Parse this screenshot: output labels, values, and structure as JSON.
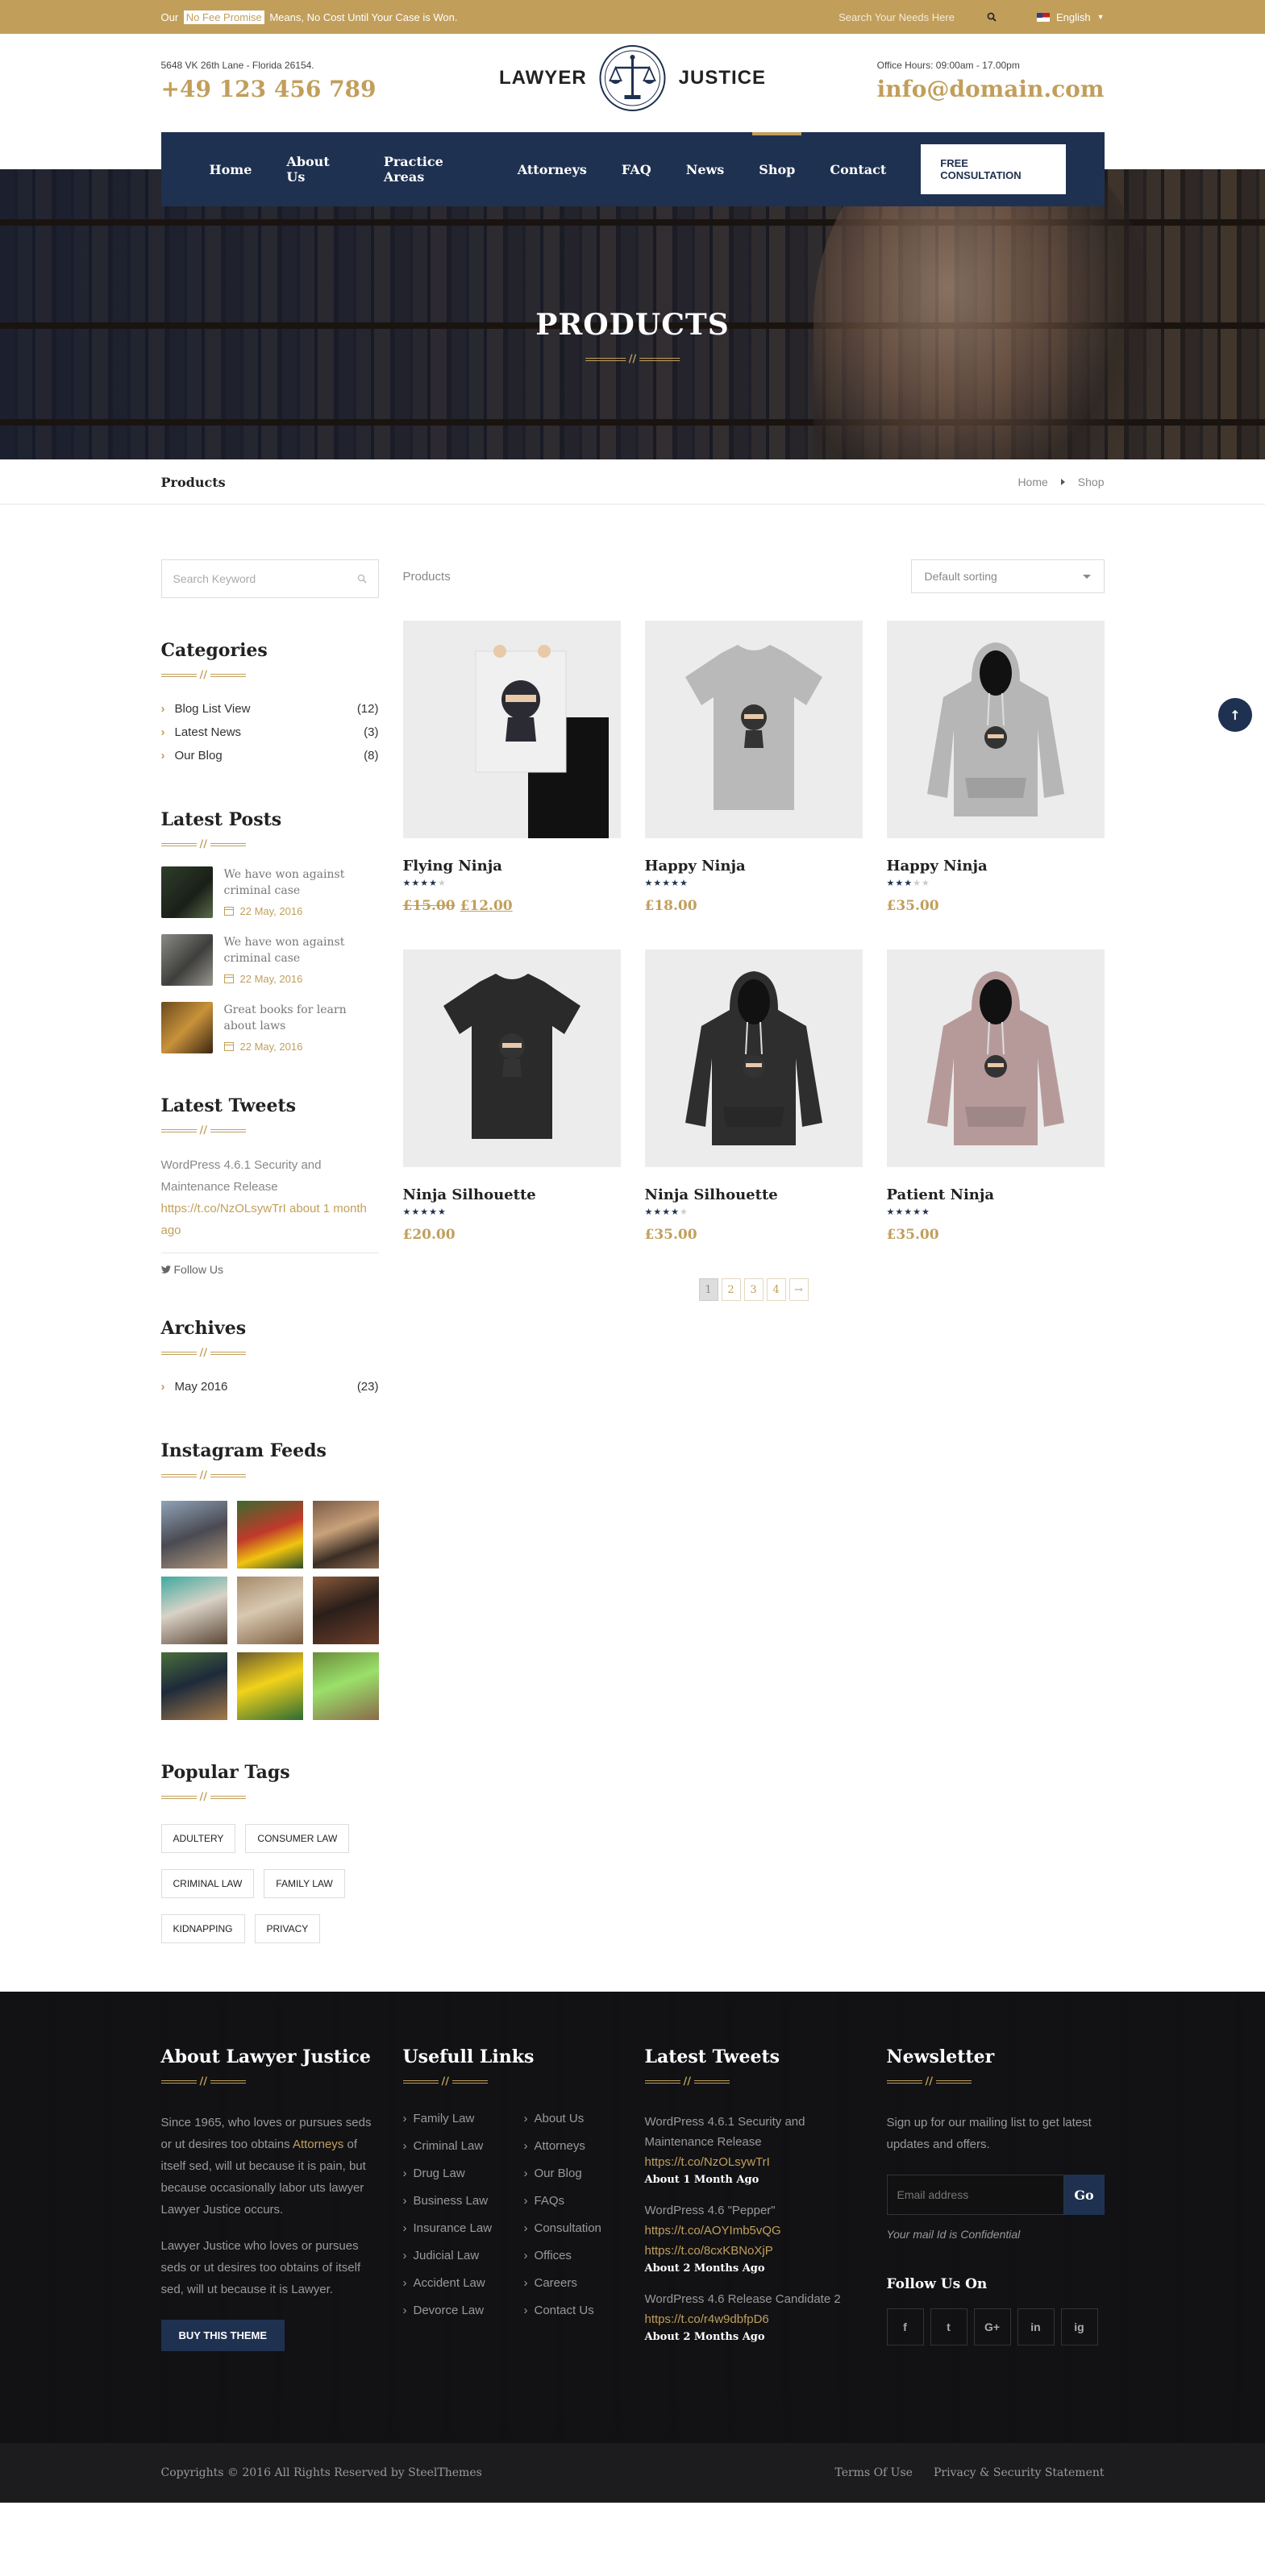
{
  "topbar": {
    "promise_pre": "Our",
    "promise_label": "No Fee Promise",
    "promise_post": "Means, No Cost Until Your Case is Won.",
    "search_placeholder": "Search Your Needs Here",
    "language": "English"
  },
  "header": {
    "address": "5648 VK 26th Lane - Florida 26154.",
    "phone": "+49 123 456 789",
    "office_hours": "Office Hours: 09:00am - 17.00pm",
    "email": "info@domain.com",
    "logo_left": "LAWYER",
    "logo_right": "JUSTICE"
  },
  "nav": {
    "items": [
      "Home",
      "About Us",
      "Practice Areas",
      "Attorneys",
      "FAQ",
      "News",
      "Shop",
      "Contact"
    ],
    "active": "Shop",
    "cta": "FREE CONSULTATION"
  },
  "banner": {
    "title": "PRODUCTS"
  },
  "breadcrumb": {
    "page_title": "Products",
    "home": "Home",
    "current": "Shop"
  },
  "sidebar": {
    "search_placeholder": "Search Keyword",
    "categories_title": "Categories",
    "categories": [
      {
        "name": "Blog List View",
        "count": "(12)"
      },
      {
        "name": "Latest News",
        "count": "(3)"
      },
      {
        "name": "Our Blog",
        "count": "(8)"
      }
    ],
    "posts_title": "Latest Posts",
    "posts": [
      {
        "title": "We have won against criminal case",
        "date": "22 May, 2016"
      },
      {
        "title": "We have won against criminal case",
        "date": "22 May, 2016"
      },
      {
        "title": "Great books for learn about laws",
        "date": "22 May, 2016"
      }
    ],
    "tweets_title": "Latest Tweets",
    "tweet_text": "WordPress 4.6.1 Security and Maintenance Release",
    "tweet_link": "https://t.co/NzOLsywTrI",
    "tweet_ago": "about 1 month ago",
    "follow_us": "Follow Us",
    "archives_title": "Archives",
    "archives": [
      {
        "name": "May 2016",
        "count": "(23)"
      }
    ],
    "instagram_title": "Instagram Feeds",
    "tags_title": "Popular Tags",
    "tags": [
      "ADULTERY",
      "CONSUMER LAW",
      "CRIMINAL LAW",
      "FAMILY LAW",
      "KIDNAPPING",
      "PRIVACY"
    ]
  },
  "content": {
    "label": "Products",
    "sort_selected": "Default sorting",
    "products": [
      {
        "name": "Flying Ninja",
        "rating": 4,
        "old_price": "£15.00",
        "price": "£12.00",
        "kind": "poster",
        "color": "#f0f0f0"
      },
      {
        "name": "Happy Ninja",
        "rating": 5,
        "old_price": "",
        "price": "£18.00",
        "kind": "tshirt",
        "color": "#b9b9b9"
      },
      {
        "name": "Happy Ninja",
        "rating": 3,
        "old_price": "",
        "price": "£35.00",
        "kind": "hoodie",
        "color": "#b6b6b6"
      },
      {
        "name": "Ninja Silhouette",
        "rating": 5,
        "old_price": "",
        "price": "£20.00",
        "kind": "tshirt",
        "color": "#2a2a2a"
      },
      {
        "name": "Ninja Silhouette",
        "rating": 4,
        "old_price": "",
        "price": "£35.00",
        "kind": "hoodie",
        "color": "#2e2e2e"
      },
      {
        "name": "Patient Ninja",
        "rating": 5,
        "old_price": "",
        "price": "£35.00",
        "kind": "hoodie",
        "color": "#b69a9a"
      }
    ],
    "pages": [
      "1",
      "2",
      "3",
      "4",
      "→"
    ],
    "current_page": "1"
  },
  "footer": {
    "about_title": "About Lawyer Justice",
    "about_text_1_pre": "Since 1965, who loves or pursues seds or ut desires too obtains",
    "about_text_1_hl": "Attorneys",
    "about_text_1_post": "of itself sed, will ut because it is pain, but because occasionally labor uts lawyer Lawyer Justice occurs.",
    "about_text_2": "Lawyer Justice who loves or pursues seds or ut desires too obtains of itself sed, will ut because it is Lawyer.",
    "buy_button": "BUY THIS THEME",
    "links_title": "Usefull Links",
    "links": [
      "Family Law",
      "About Us",
      "Criminal Law",
      "Attorneys",
      "Drug Law",
      "Our Blog",
      "Business Law",
      "FAQs",
      "Insurance Law",
      "Consultation",
      "Judicial Law",
      "Offices",
      "Accident Law",
      "Careers",
      "Devorce Law",
      "Contact Us"
    ],
    "tweets_title": "Latest Tweets",
    "tweets": [
      {
        "text": "WordPress 4.6.1 Security and Maintenance Release",
        "link": "https://t.co/NzOLsywTrI",
        "ago": "About 1 Month Ago"
      },
      {
        "text": "WordPress 4.6 \"Pepper\"",
        "link": "https://t.co/AOYImb5vQG https://t.co/8cxKBNoXjP",
        "ago": "About 2 Months Ago"
      },
      {
        "text": "WordPress 4.6 Release Candidate 2",
        "link": "https://t.co/r4w9dbfpD6",
        "ago": "About 2 Months Ago"
      }
    ],
    "newsletter_title": "Newsletter",
    "newsletter_text": "Sign up for our mailing list to get latest updates and offers.",
    "email_placeholder": "Email address",
    "go": "Go",
    "confidential": "Your mail Id is Confidential",
    "follow_title": "Follow Us On",
    "socials": [
      "f",
      "t",
      "G+",
      "in",
      "ig"
    ]
  },
  "bottom": {
    "copyright": "Copyrights © 2016 All Rights Reserved by SteelThemes",
    "terms": "Terms Of Use",
    "privacy": "Privacy & Security Statement"
  },
  "colors": {
    "gold": "#c19f5b",
    "navy": "#1f3150"
  }
}
